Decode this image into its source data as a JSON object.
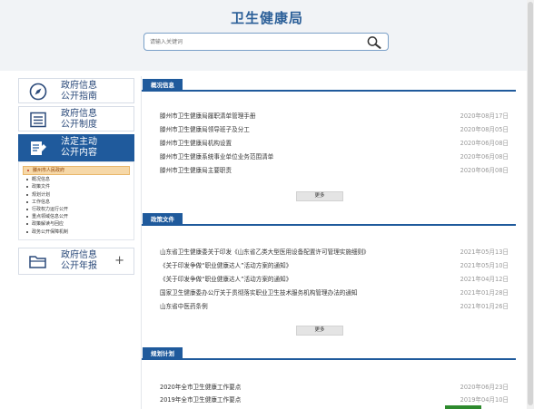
{
  "site": {
    "title": "卫生健康局"
  },
  "search": {
    "placeholder": "请输入关键词"
  },
  "sidebar": {
    "items": [
      {
        "label_line1": "政府信息",
        "label_line2": "公开指南"
      },
      {
        "label_line1": "政府信息",
        "label_line2": "公开制度"
      },
      {
        "label_line1": "法定主动",
        "label_line2": "公开内容"
      },
      {
        "label_line1": "政府信息",
        "label_line2": "公开年报",
        "plus": "+"
      }
    ],
    "submenu": [
      "滕州市人民政府",
      "概况信息",
      "政策文件",
      "规划计划",
      "工作信息",
      "行政权力运行公开",
      "重点领域信息公开",
      "政策解读与回应",
      "政务公开保障机制"
    ]
  },
  "sections": [
    {
      "title": "概况信息",
      "items": [
        {
          "title": "滕州市卫生健康局履职清单管理手册",
          "date": "2020年08月17日"
        },
        {
          "title": "滕州市卫生健康局领导班子及分工",
          "date": "2020年08月05日"
        },
        {
          "title": "滕州市卫生健康局机构设置",
          "date": "2020年06月08日"
        },
        {
          "title": "滕州市卫生健康系统事业单位业务范围清单",
          "date": "2020年06月08日"
        },
        {
          "title": "滕州市卫生健康局主要职责",
          "date": "2020年06月08日"
        }
      ],
      "more": "更多"
    },
    {
      "title": "政策文件",
      "items": [
        {
          "title": "山东省卫生健康委关于印发《山东省乙类大型医用设备配置许可管理实施细则》",
          "date": "2021年05月13日"
        },
        {
          "title": "《关于印发争做“职业健康达人”活动方案的通知》",
          "date": "2021年05月10日"
        },
        {
          "title": "《关于印发争做“职业健康达人”活动方案的通知》",
          "date": "2021年04月12日"
        },
        {
          "title": "国家卫生健康委办公厅关于贯彻落实职业卫生技术服务机构管理办法的通知",
          "date": "2021年01月28日"
        },
        {
          "title": "山东省中医药条例",
          "date": "2021年01月26日"
        }
      ],
      "more": "更多"
    },
    {
      "title": "规划计划",
      "items": [
        {
          "title": "2020年全市卫生健康工作要点",
          "date": "2020年06月23日"
        },
        {
          "title": "2019年全市卫生健康工作要点",
          "date": "2019年04月10日"
        }
      ]
    }
  ],
  "colors": {
    "primary": "#1f5a9c",
    "title": "#2b5f98",
    "header_bg": "#f1f3f6",
    "active_sub": "#f6d8a8"
  }
}
